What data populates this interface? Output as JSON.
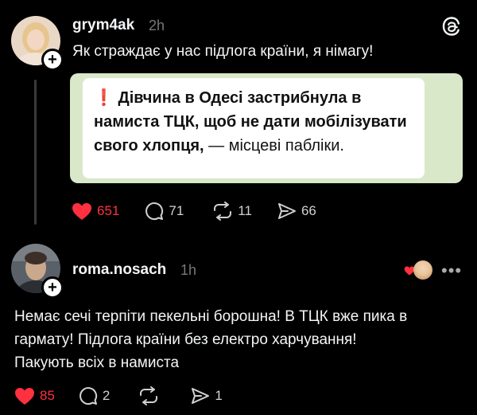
{
  "post1": {
    "username": "grym4ak",
    "time": "2h",
    "text": "Як страждає у нас підлога  країни, я німагу!",
    "quote": {
      "excl": "❗",
      "bold": "Дівчина в Одесі застрибнула в намиста ТЦК, щоб не дати мобілізувати свого хлопця,",
      "rest": " — місцеві пабліки."
    },
    "likes": "651",
    "comments": "71",
    "reposts": "11",
    "shares": "66"
  },
  "post2": {
    "username": "roma.nosach",
    "time": "1h",
    "lines": [
      "Немає сечі терпіти пекельні борошна! В ТЦК вже пика в",
      "гармату! Підлога країни без електро харчування!",
      "Пакують всіх в намиста"
    ],
    "likes": "85",
    "comments": "2",
    "shares": "1"
  },
  "colors": {
    "background": "#000000",
    "like": "#ff3040",
    "muted": "#777777",
    "quote_bg": "#d9e8c9"
  },
  "icons": [
    "plus-icon",
    "threads-logo-icon",
    "heart-icon",
    "comment-icon",
    "repost-icon",
    "share-icon",
    "more-icon"
  ]
}
